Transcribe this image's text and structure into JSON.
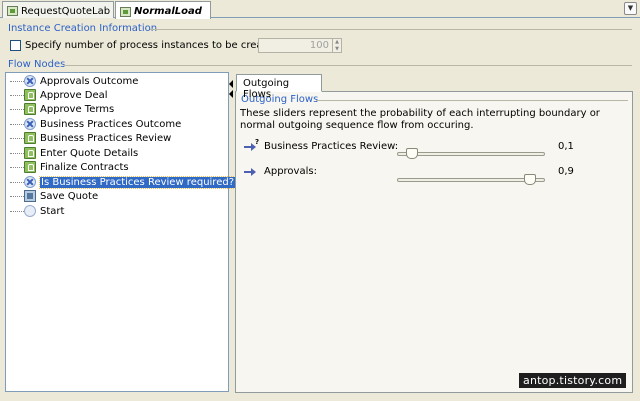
{
  "tabs": [
    {
      "label": "RequestQuoteLab",
      "active": false,
      "icon": "process-icon"
    },
    {
      "label": "NormalLoad",
      "active": true,
      "icon": "load-icon"
    }
  ],
  "instance_creation": {
    "title": "Instance Creation Information",
    "checkbox_label": "Specify number of process instances to be created",
    "checked": false,
    "instances_value": "100"
  },
  "flow_nodes": {
    "title": "Flow Nodes",
    "items": [
      {
        "label": "Approvals Outcome",
        "icon": "gateway-icon"
      },
      {
        "label": "Approve Deal",
        "icon": "user-task-icon"
      },
      {
        "label": "Approve Terms",
        "icon": "user-task-icon"
      },
      {
        "label": "Business Practices Outcome",
        "icon": "gateway-icon"
      },
      {
        "label": "Business Practices Review",
        "icon": "user-task-icon"
      },
      {
        "label": "Enter Quote Details",
        "icon": "user-task-icon"
      },
      {
        "label": "Finalize Contracts",
        "icon": "user-task-icon"
      },
      {
        "label": "Is Business Practices Review required?",
        "icon": "gateway-icon",
        "selected": true
      },
      {
        "label": "Save Quote",
        "icon": "script-task-icon"
      },
      {
        "label": "Start",
        "icon": "start-event-icon"
      }
    ]
  },
  "outgoing_flows": {
    "tab_label": "Outgoing Flows",
    "group_title": "Outgoing Flows",
    "description": "These sliders represent the probability of each interrupting boundary or normal outgoing sequence flow from occuring.",
    "sliders": [
      {
        "label": "Business Practices Review:",
        "value_text": "0,1",
        "value": 0.1
      },
      {
        "label": "Approvals:",
        "value_text": "0,9",
        "value": 0.9
      }
    ]
  },
  "watermark": "antop.tistory.com",
  "colors": {
    "accent": "#2c61c9",
    "selection": "#316ac5",
    "background": "#ece9d8"
  }
}
